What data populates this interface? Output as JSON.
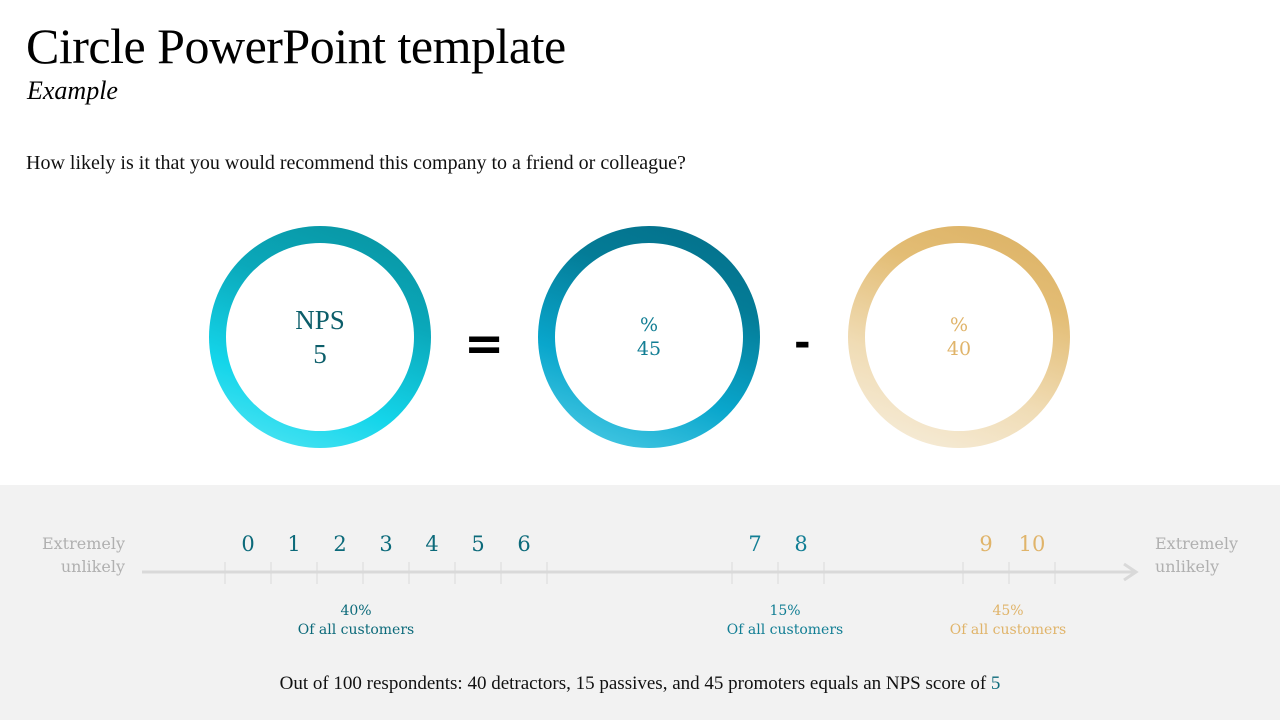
{
  "header": {
    "title": "Circle PowerPoint template",
    "subtitle": "Example"
  },
  "question": "How likely is it that you would recommend this company to a friend or colleague?",
  "equation": {
    "nps": {
      "label": "NPS",
      "value": "5"
    },
    "equals_sign": "=",
    "promoters": {
      "symbol": "%",
      "value": "45",
      "color": "#127e94"
    },
    "minus_sign": "-",
    "detractors": {
      "symbol": "%",
      "value": "40",
      "color": "#e0b46a"
    }
  },
  "scale": {
    "left_label": [
      "Extremely",
      "unlikely"
    ],
    "right_label": [
      "Extremely",
      "unlikely"
    ],
    "groups": [
      {
        "name": "detractors",
        "numbers": [
          "0",
          "1",
          "2",
          "3",
          "4",
          "5",
          "6"
        ],
        "percent": "40%",
        "caption": "Of all customers",
        "color": "#0c6a7a"
      },
      {
        "name": "passives",
        "numbers": [
          "7",
          "8"
        ],
        "percent": "15%",
        "caption": "Of all customers",
        "color": "#127e94"
      },
      {
        "name": "promoters",
        "numbers": [
          "9",
          "10"
        ],
        "percent": "45%",
        "caption": "Of all customers",
        "color": "#e0b46a"
      }
    ]
  },
  "summary": {
    "text": "Out of 100 respondents: 40 detractors, 15 passives, and 45 promoters equals an NPS score of ",
    "score": "5"
  }
}
